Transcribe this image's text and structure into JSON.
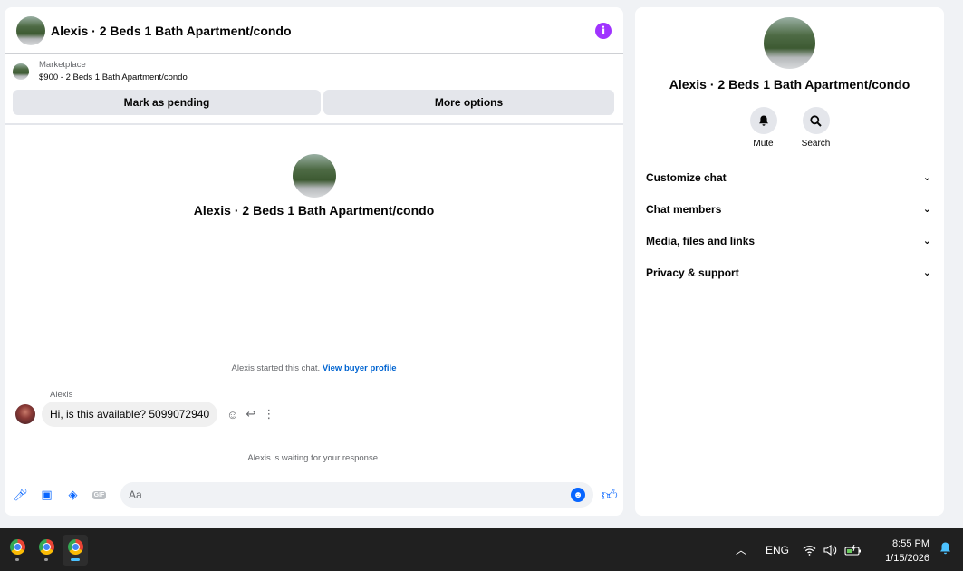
{
  "chat": {
    "title": "Alexis · 2 Beds 1 Bath Apartment/condo",
    "info_icon": "i",
    "marketplace": {
      "label": "Marketplace",
      "listing": "$900 - 2 Beds 1 Bath Apartment/condo"
    },
    "actions": {
      "mark_pending": "Mark as pending",
      "more_options": "More options"
    },
    "hero_title": "Alexis · 2 Beds 1 Bath Apartment/condo",
    "started_text": "Alexis started this chat.",
    "buyer_profile_link": "View buyer profile",
    "message": {
      "sender": "Alexis",
      "text": "Hi, is this available? 5099072940"
    },
    "waiting_text": "Alexis is waiting for your response.",
    "composer": {
      "placeholder": "Aa",
      "gif_label": "GIF"
    }
  },
  "info_panel": {
    "title": "Alexis · 2 Beds 1 Bath Apartment/condo",
    "actions": [
      {
        "label": "Mute",
        "icon": "bell-icon"
      },
      {
        "label": "Search",
        "icon": "search-icon"
      }
    ],
    "sections": [
      "Customize chat",
      "Chat members",
      "Media, files and links",
      "Privacy & support"
    ]
  },
  "taskbar": {
    "apps": [
      "chrome-icon",
      "chrome-icon",
      "chrome-icon"
    ],
    "language": "ENG",
    "time": "8:55 PM",
    "date": "1/15/2026"
  },
  "colors": {
    "accent": "#0866ff",
    "info": "#a033ff",
    "link": "#0064d1",
    "taskbar": "#202020"
  }
}
